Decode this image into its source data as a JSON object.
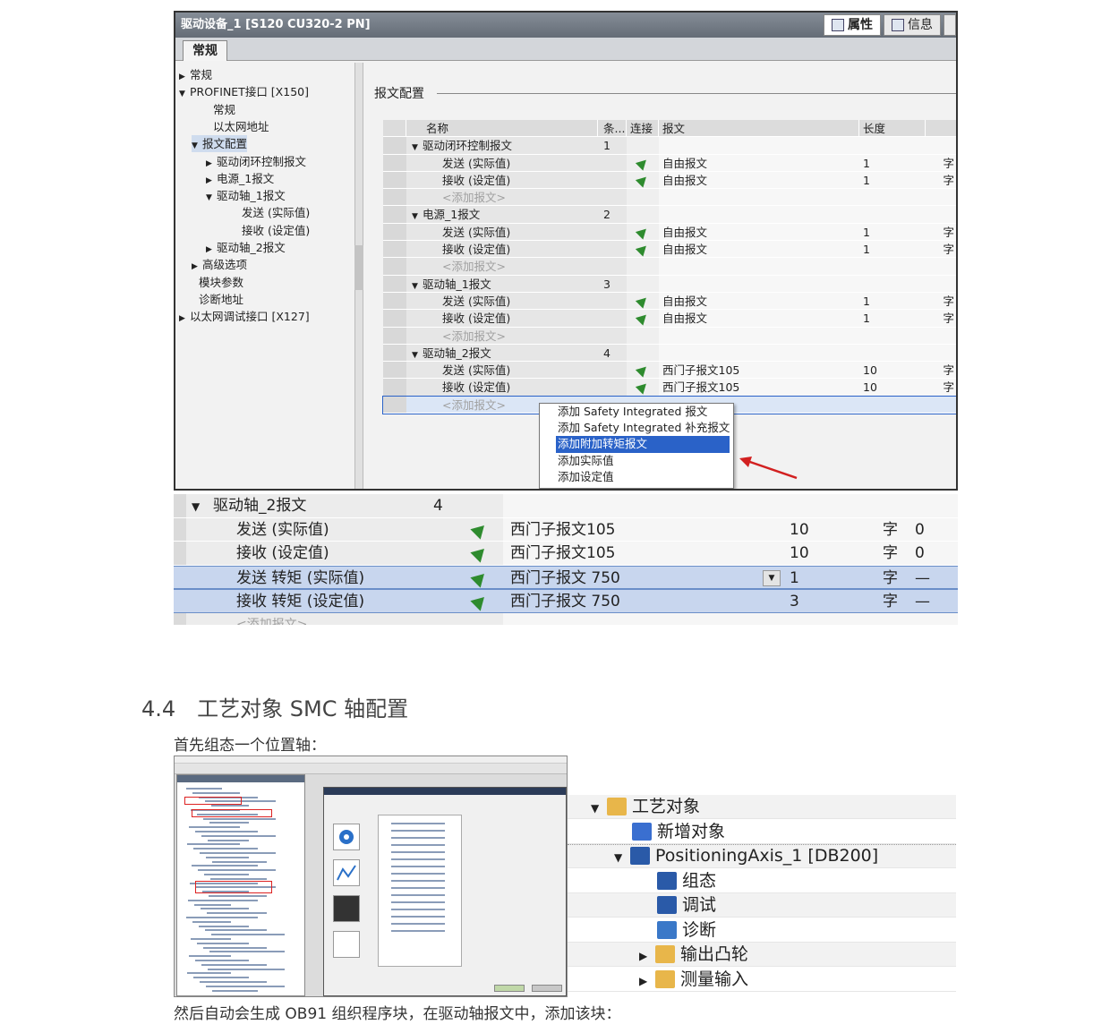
{
  "fig1": {
    "title": "驱动设备_1 [S120 CU320-2 PN]",
    "tabs": [
      "属性",
      "信息"
    ],
    "subtab": "常规",
    "nav": [
      {
        "label": "常规",
        "arrow": "right"
      },
      {
        "label": "PROFINET接口 [X150]",
        "arrow": "down"
      },
      {
        "label": "常规",
        "arrow": ""
      },
      {
        "label": "以太网地址",
        "arrow": ""
      },
      {
        "label": "报文配置",
        "arrow": "down",
        "selected": true
      },
      {
        "label": "驱动闭环控制报文",
        "arrow": "right"
      },
      {
        "label": "电源_1报文",
        "arrow": "right"
      },
      {
        "label": "驱动轴_1报文",
        "arrow": "down"
      },
      {
        "label": "发送 (实际值)",
        "arrow": ""
      },
      {
        "label": "接收 (设定值)",
        "arrow": ""
      },
      {
        "label": "驱动轴_2报文",
        "arrow": "right"
      },
      {
        "label": "高级选项",
        "arrow": "right"
      },
      {
        "label": "模块参数",
        "arrow": ""
      },
      {
        "label": "诊断地址",
        "arrow": ""
      },
      {
        "label": "以太网调试接口 [X127]",
        "arrow": "right"
      }
    ],
    "section_title": "报文配置",
    "columns": {
      "name": "名称",
      "num": "条...",
      "link": "连接",
      "telegram": "报文",
      "length": "长度"
    },
    "rows": [
      {
        "name": "驱动闭环控制报文",
        "group": true,
        "num": "1"
      },
      {
        "name": "发送 (实际值)",
        "link": true,
        "telegram": "自由报文",
        "length": "1",
        "unit": "字"
      },
      {
        "name": "接收 (设定值)",
        "link": true,
        "telegram": "自由报文",
        "length": "1",
        "unit": "字"
      },
      {
        "name": "<添加报文>",
        "add": true
      },
      {
        "name": "电源_1报文",
        "group": true,
        "num": "2"
      },
      {
        "name": "发送 (实际值)",
        "link": true,
        "telegram": "自由报文",
        "length": "1",
        "unit": "字"
      },
      {
        "name": "接收 (设定值)",
        "link": true,
        "telegram": "自由报文",
        "length": "1",
        "unit": "字"
      },
      {
        "name": "<添加报文>",
        "add": true
      },
      {
        "name": "驱动轴_1报文",
        "group": true,
        "num": "3"
      },
      {
        "name": "发送 (实际值)",
        "link": true,
        "telegram": "自由报文",
        "length": "1",
        "unit": "字"
      },
      {
        "name": "接收 (设定值)",
        "link": true,
        "telegram": "自由报文",
        "length": "1",
        "unit": "字"
      },
      {
        "name": "<添加报文>",
        "add": true
      },
      {
        "name": "驱动轴_2报文",
        "group": true,
        "num": "4"
      },
      {
        "name": "发送 (实际值)",
        "link": true,
        "telegram": "西门子报文105",
        "length": "10",
        "unit": "字"
      },
      {
        "name": "接收 (设定值)",
        "link": true,
        "telegram": "西门子报文105",
        "length": "10",
        "unit": "字"
      },
      {
        "name": "<添加报文>",
        "add": true,
        "selected": true
      }
    ],
    "context_menu": [
      "添加 Safety Integrated 报文",
      "添加 Safety Integrated 补充报文",
      "添加附加转矩报文",
      "添加实际值",
      "添加设定值"
    ],
    "context_menu_highlight": 2
  },
  "fig2": {
    "rows": [
      {
        "name": "驱动轴_2报文",
        "group": true,
        "num": "4"
      },
      {
        "name": "发送 (实际值)",
        "telegram": "西门子报文105",
        "length": "10",
        "unit": "字",
        "extra": "0"
      },
      {
        "name": "接收 (设定值)",
        "telegram": "西门子报文105",
        "length": "10",
        "unit": "字",
        "extra": "0"
      },
      {
        "name": "发送 转矩 (实际值)",
        "telegram": "西门子报文 750",
        "length": "1",
        "unit": "字",
        "extra": "—",
        "selected": true
      },
      {
        "name": "接收 转矩 (设定值)",
        "telegram": "西门子报文 750",
        "length": "3",
        "unit": "字",
        "extra": "—",
        "selected": true
      },
      {
        "name": "<添加报文>",
        "add": true
      }
    ]
  },
  "text": {
    "heading": "4.4　工艺对象 SMC 轴配置",
    "para1": "首先组态一个位置轴：",
    "para2": "然后自动会生成 OB91 组织程序块，在驱动轴报文中，添加该块："
  },
  "fig4": {
    "items": [
      {
        "label": "工艺对象",
        "arrow": "down",
        "indent": 0,
        "icon": "folder-icon"
      },
      {
        "label": "新增对象",
        "arrow": "",
        "indent": 1,
        "icon": "new-object-icon"
      },
      {
        "label": "PositioningAxis_1 [DB200]",
        "arrow": "down",
        "indent": 1,
        "icon": "axis-icon"
      },
      {
        "label": "组态",
        "arrow": "",
        "indent": 2,
        "icon": "config-icon"
      },
      {
        "label": "调试",
        "arrow": "",
        "indent": 2,
        "icon": "commissioning-icon"
      },
      {
        "label": "诊断",
        "arrow": "",
        "indent": 2,
        "icon": "diagnostics-icon"
      },
      {
        "label": "输出凸轮",
        "arrow": "right",
        "indent": 2,
        "icon": "folder-icon"
      },
      {
        "label": "测量输入",
        "arrow": "right",
        "indent": 2,
        "icon": "folder-icon"
      }
    ]
  },
  "colors": {
    "link_icon": "#2e8b2e",
    "highlight": "#2a62c8",
    "selected_row": "#c8d6ee",
    "red_arrow": "#d22020"
  }
}
